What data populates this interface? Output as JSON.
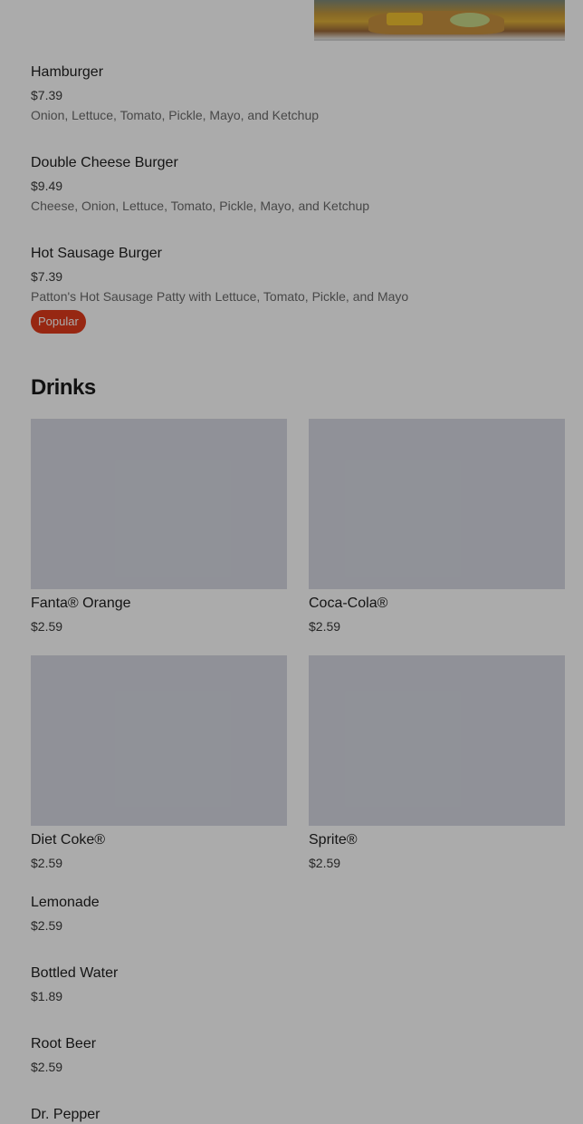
{
  "burgers": [
    {
      "name": "Hamburger",
      "price": "$7.39",
      "description": "Onion, Lettuce, Tomato, Pickle, Mayo, and Ketchup"
    },
    {
      "name": "Double Cheese Burger",
      "price": "$9.49",
      "description": "Cheese, Onion, Lettuce, Tomato, Pickle, Mayo, and Ketchup"
    },
    {
      "name": "Hot Sausage Burger",
      "price": "$7.39",
      "description": "Patton's Hot Sausage Patty with Lettuce, Tomato, Pickle, and Mayo",
      "badge": "Popular"
    }
  ],
  "drinks_section": {
    "title": "Drinks",
    "cards": [
      {
        "name": "Fanta® Orange",
        "price": "$2.59"
      },
      {
        "name": "Coca-Cola®",
        "price": "$2.59"
      },
      {
        "name": "Diet Coke®",
        "price": "$2.59"
      },
      {
        "name": "Sprite®",
        "price": "$2.59"
      }
    ],
    "list": [
      {
        "name": "Lemonade",
        "price": "$2.59"
      },
      {
        "name": "Bottled Water",
        "price": "$1.89"
      },
      {
        "name": "Root Beer",
        "price": "$2.59"
      },
      {
        "name": "Dr. Pepper"
      }
    ]
  },
  "colors": {
    "badge": "#e23b1c",
    "image_placeholder": "#d7d9e3",
    "overlay": "rgba(0,0,0,0.33)"
  }
}
